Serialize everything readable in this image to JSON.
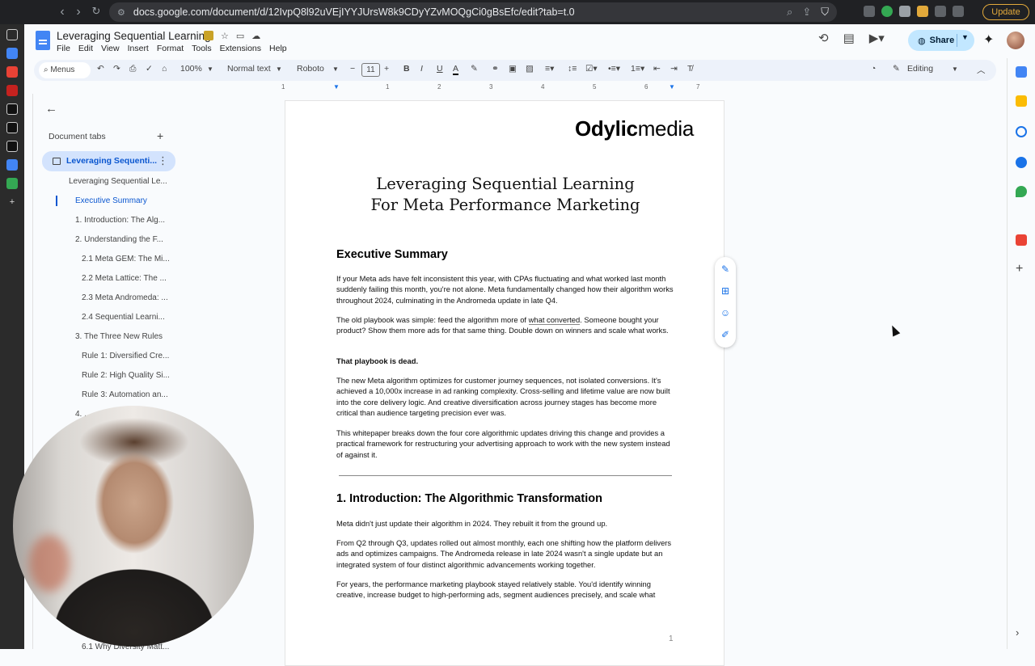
{
  "browser": {
    "url": "docs.google.com/document/d/12IvpQ8l92uVEjIYYJUrsW8k9CDyYZvMOQgCi0gBsEfc/edit?tab=t.0",
    "update_label": "Update"
  },
  "header": {
    "title": "Leveraging Sequential Learning",
    "menu": [
      "File",
      "Edit",
      "View",
      "Insert",
      "Format",
      "Tools",
      "Extensions",
      "Help"
    ],
    "share_label": "Share"
  },
  "toolbar": {
    "menus_label": "Menus",
    "zoom": "100%",
    "style": "Normal text",
    "font": "Roboto",
    "font_size": "11",
    "mode": "Editing"
  },
  "ruler": {
    "ticks": [
      "1",
      "1",
      "2",
      "3",
      "4",
      "5",
      "6",
      "7"
    ]
  },
  "tabs_panel": {
    "title": "Document tabs",
    "active_tab": "Leveraging Sequenti...",
    "outline": [
      "Leveraging Sequential Le...",
      "Executive Summary",
      "1. Introduction: The Alg...",
      "2. Understanding the F...",
      "2.1 Meta GEM: The Mi...",
      "2.2 Meta Lattice: The ...",
      "2.3 Meta Andromeda: ...",
      "2.4 Sequential Learni...",
      "3. The Three New Rules",
      "Rule 1: Diversified Cre...",
      "Rule 2: High Quality Si...",
      "Rule 3: Automation an...",
      "4. ...",
      "6.1 Why Diversity Matt..."
    ]
  },
  "document": {
    "brand_bold": "Odylic",
    "brand_light": "media",
    "title_line1": "Leveraging Sequential Learning",
    "title_line2": "For Meta Performance Marketing",
    "h_exec": "Executive Summary",
    "p1": "If your Meta ads have felt inconsistent this year, with CPAs fluctuating and what worked last month suddenly failing this month, you're not alone. Meta fundamentally changed how their algorithm works throughout 2024, culminating in the Andromeda update in late Q4.",
    "p2a": "The old playbook was simple: feed the algorithm more of ",
    "p2link": "what converted",
    "p2b": ". Someone bought your product? Show them more ads for that same thing. Double down on winners and scale what works.",
    "p3": "That playbook is dead.",
    "p4": "The new Meta algorithm optimizes for customer journey sequences, not isolated conversions. It's achieved a 10,000x increase in ad ranking complexity. Cross-selling and lifetime value are now built into the core delivery logic. And creative diversification across journey stages has become more critical than audience targeting precision ever was.",
    "p5": "This whitepaper breaks down the four core algorithmic updates driving this change and provides a practical framework for restructuring your advertising approach to work with the new system instead of against it.",
    "h_intro": "1. Introduction: The Algorithmic Transformation",
    "p6": "Meta didn't just update their algorithm in 2024. They rebuilt it from the ground up.",
    "p7": "From Q2 through Q3, updates rolled out almost monthly, each one shifting how the platform delivers ads and optimizes campaigns. The Andromeda release in late 2024 wasn't a single update but an integrated system of four distinct algorithmic advancements working together.",
    "p8": "For years, the performance marketing playbook stayed relatively stable. You'd identify winning creative, increase budget to high-performing ads, segment audiences precisely, and scale what",
    "page_number": "1"
  }
}
